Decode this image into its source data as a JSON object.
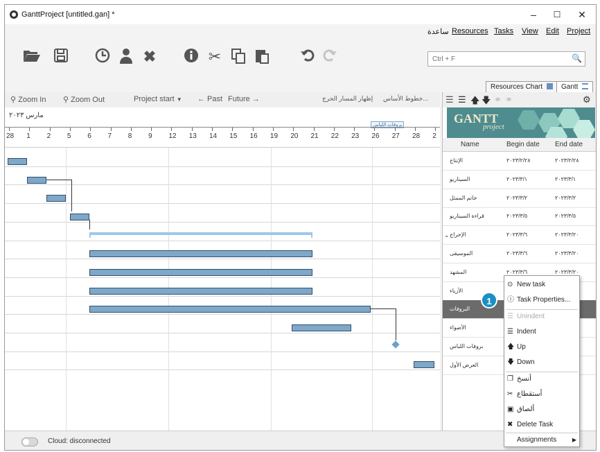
{
  "window": {
    "title": "GanttProject [untitled.gan] *",
    "minimize": "–",
    "maximize": "☐",
    "close": "✕"
  },
  "menu": [
    "ساعدة",
    "Resources",
    "Tasks",
    "View",
    "Edit",
    "Project"
  ],
  "search": {
    "placeholder": "Ctrl + F"
  },
  "tabs": {
    "resources_chart": "Resources Chart",
    "gantt": "Gantt"
  },
  "gantt_toolbar": {
    "zoom_in": "Zoom In",
    "zoom_out": "Zoom Out",
    "project_start": "Project start",
    "past": "← Past",
    "future": "Future →",
    "baselines": "خطوط الأساس...",
    "critical_path": "إظهار المسار الحرج"
  },
  "timeline": {
    "month": "مارس ٢٠٢٣",
    "days": [
      "28",
      "1",
      "2",
      "5",
      "6",
      "7",
      "8",
      "9",
      "12",
      "13",
      "14",
      "15",
      "16",
      "19",
      "20",
      "21",
      "22",
      "23",
      "26",
      "27",
      "28",
      "2"
    ],
    "header_marker": "بروفات اللباس"
  },
  "logo": {
    "text": "GANTT",
    "sub": "project"
  },
  "task_table": {
    "headers": {
      "name": "Name",
      "begin": "Begin date",
      "end": "End date"
    },
    "rows": [
      {
        "name": "الإنتاج",
        "begin": "٢٠٢٣/٢/٢٨",
        "end": "٢٠٢٣/٢/٢٨"
      },
      {
        "name": "السيناريو",
        "begin": "٢٠٢٣/٣/١",
        "end": "٢٠٢٣/٣/١"
      },
      {
        "name": "خاتم الممثل",
        "begin": "٢٠٢٣/٣/٢",
        "end": "٢٠٢٣/٣/٢"
      },
      {
        "name": "قراءة السيناريو",
        "begin": "٢٠٢٣/٣/٥",
        "end": "٢٠٢٣/٣/٥"
      },
      {
        "name": "الإخراج",
        "begin": "٢٠٢٣/٣/٦",
        "end": "٢٠٢٣/٣/٢٠"
      },
      {
        "name": "الموسيقى",
        "begin": "٢٠٢٣/٣/٦",
        "end": "٢٠٢٣/٣/٢٠"
      },
      {
        "name": "المشهد",
        "begin": "٢٠٢٣/٣/٦",
        "end": "٢٠٢٣/٣/٢٠"
      },
      {
        "name": "الأزياء",
        "begin": "",
        "end": ""
      },
      {
        "name": "البروفات",
        "begin": "",
        "end": ""
      },
      {
        "name": "الأضواء",
        "begin": "",
        "end": ""
      },
      {
        "name": "بروفات اللباس",
        "begin": "",
        "end": ""
      },
      {
        "name": "العرض الأول",
        "begin": "",
        "end": ""
      }
    ]
  },
  "context_menu": {
    "new_task": "New task",
    "task_properties": "Task Properties...",
    "unindent": "Unindent",
    "indent": "Indent",
    "up": "Up",
    "down": "Down",
    "copy": "أنسخ",
    "cut": "أستقطاع",
    "paste": "ألصاق",
    "delete_task": "Delete Task",
    "assignments": "Assignments"
  },
  "callout": "1",
  "status": {
    "cloud": "Cloud: disconnected"
  }
}
